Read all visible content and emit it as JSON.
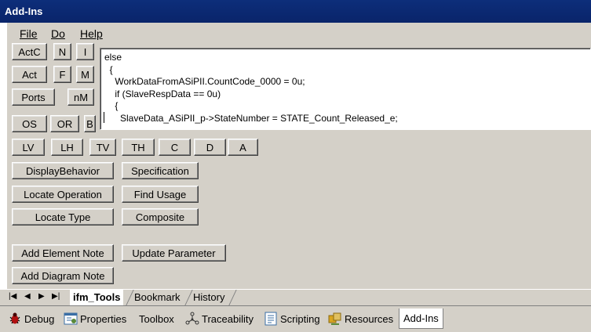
{
  "window": {
    "title": "Add-Ins"
  },
  "menu": {
    "file": "File",
    "do": "Do",
    "help": "Help"
  },
  "toolbar": {
    "actc": "ActC",
    "n": "N",
    "i": "I",
    "act": "Act",
    "f": "F",
    "m": "M",
    "ports": "Ports",
    "nm": "nM",
    "os": "OS",
    "or": "OR",
    "b": "B"
  },
  "editor": {
    "lines": [
      "else",
      "  {",
      "    WorkDataFromASiPII.CountCode_0000 = 0u;",
      "    if (SlaveRespData == 0u)",
      "    {",
      "      SlaveData_ASiPII_p->StateNumber = STATE_Count_Released_e;"
    ]
  },
  "row_buttons": {
    "lv": "LV",
    "lh": "LH",
    "tv": "TV",
    "th": "TH",
    "c": "C",
    "d": "D",
    "a": "A"
  },
  "actions": {
    "display_behavior": "DisplayBehavior",
    "specification": "Specification",
    "locate_operation": "Locate Operation",
    "find_usage": "Find Usage",
    "locate_type": "Locate Type",
    "composite": "Composite",
    "add_element_note": "Add Element Note",
    "update_parameter": "Update Parameter",
    "add_diagram_note": "Add Diagram Note"
  },
  "sheet_tabs": [
    "ifm_Tools",
    "Bookmark",
    "History"
  ],
  "bottom_tabs": [
    "Debug",
    "Properties",
    "Toolbox",
    "Traceability",
    "Scripting",
    "Resources",
    "Add-Ins"
  ]
}
